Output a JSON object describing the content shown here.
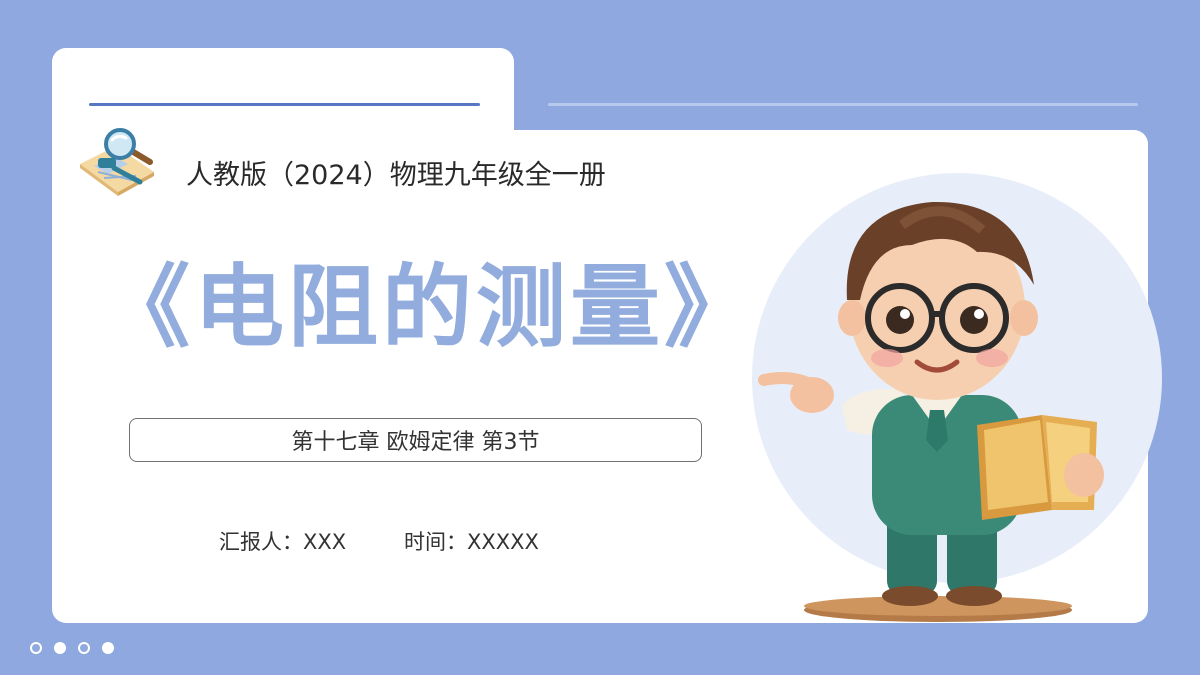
{
  "header": {
    "subtitle": "人教版（2024）物理九年级全一册"
  },
  "main": {
    "title": "《电阻的测量》",
    "chapter": "第十七章 欧姆定律 第3节",
    "reporter_label": "汇报人：",
    "reporter_value": "XXX",
    "time_label": "时间：",
    "time_value": "XXXXX"
  },
  "icons": {
    "logo": "magnifier-document-icon",
    "illustration": "teacher-with-book-illustration"
  },
  "pagination": {
    "dots": [
      "hollow",
      "filled",
      "hollow",
      "filled"
    ]
  },
  "colors": {
    "background": "#8fa9e0",
    "card": "#ffffff",
    "title": "#92acdd",
    "accent_line": "#5677c2",
    "light_line": "#b8c9ee"
  }
}
